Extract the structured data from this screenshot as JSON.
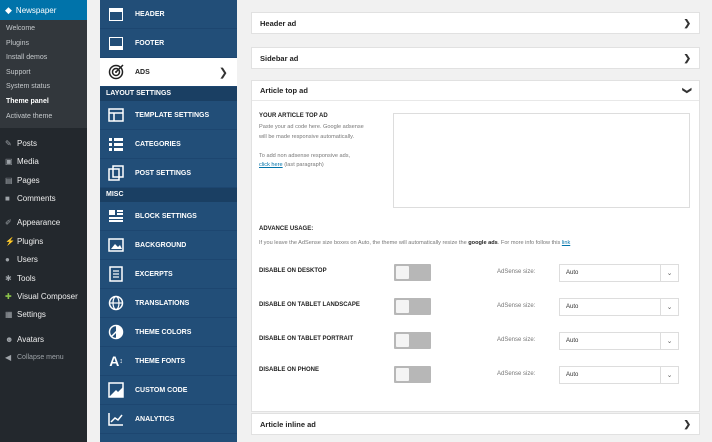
{
  "wp_menu": {
    "brand": "Newspaper",
    "submenu": [
      "Welcome",
      "Plugins",
      "Install demos",
      "Support",
      "System status",
      "Theme panel",
      "Activate theme"
    ],
    "items": [
      {
        "label": "Posts",
        "icon": "pin-icon"
      },
      {
        "label": "Media",
        "icon": "media-icon"
      },
      {
        "label": "Pages",
        "icon": "pages-icon"
      },
      {
        "label": "Comments",
        "icon": "comments-icon"
      },
      {
        "label": "Appearance",
        "icon": "appearance-icon"
      },
      {
        "label": "Plugins",
        "icon": "plugins-icon"
      },
      {
        "label": "Users",
        "icon": "users-icon"
      },
      {
        "label": "Tools",
        "icon": "tools-icon"
      },
      {
        "label": "Visual Composer",
        "icon": "composer-icon"
      },
      {
        "label": "Settings",
        "icon": "settings-icon"
      },
      {
        "label": "Avatars",
        "icon": "avatars-icon"
      },
      {
        "label": "Collapse menu",
        "icon": "collapse-icon"
      }
    ]
  },
  "panel_nav": {
    "top_items": [
      "HEADER",
      "FOOTER",
      "ADS"
    ],
    "section_layout": "LAYOUT SETTINGS",
    "layout_items": [
      "TEMPLATE SETTINGS",
      "CATEGORIES",
      "POST SETTINGS"
    ],
    "section_misc": "MISC",
    "misc_items": [
      "BLOCK SETTINGS",
      "BACKGROUND",
      "EXCERPTS",
      "TRANSLATIONS",
      "THEME COLORS",
      "THEME FONTS",
      "CUSTOM CODE",
      "ANALYTICS"
    ]
  },
  "content": {
    "header_ad": "Header ad",
    "sidebar_ad": "Sidebar ad",
    "article_top_ad": "Article top ad",
    "your_ad_label": "YOUR ARTICLE TOP AD",
    "desc_line1": "Paste your ad code here. Google adsense",
    "desc_line2": "will be made responsive automatically.",
    "desc_line3": "To add non adsense responsive ads,",
    "click_here": "click here",
    "desc_line4": " (last paragraph)",
    "advance_label": "ADVANCE USAGE:",
    "advance_text": "If you leave the AdSense size boxes on Auto, the theme will automatically resize the ",
    "advance_bold": "google ads",
    "advance_text2": ". For more info follow this ",
    "advance_link": "link",
    "rows": [
      {
        "label": "DISABLE ON DESKTOP",
        "size_label": "AdSense size:",
        "size": "Auto"
      },
      {
        "label": "DISABLE ON TABLET LANDSCAPE",
        "size_label": "AdSense size:",
        "size": "Auto"
      },
      {
        "label": "DISABLE ON TABLET PORTRAIT",
        "size_label": "AdSense size:",
        "size": "Auto"
      },
      {
        "label": "DISABLE ON PHONE",
        "size_label": "AdSense size:",
        "size": "Auto"
      }
    ],
    "article_inline_ad": "Article inline ad"
  }
}
